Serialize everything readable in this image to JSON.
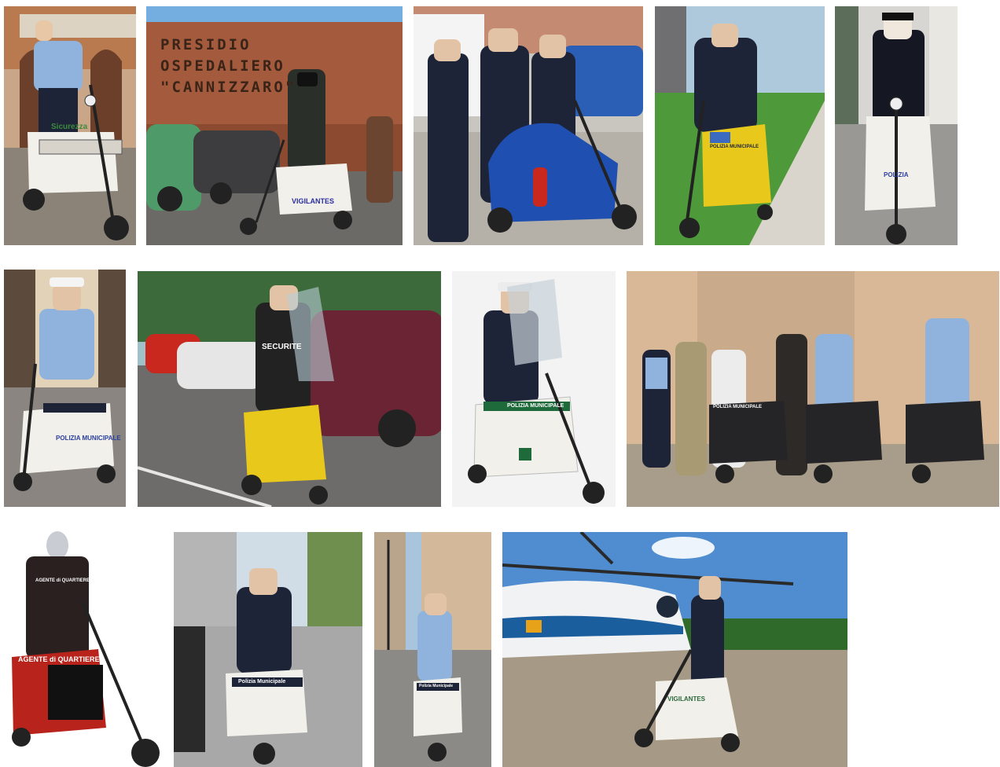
{
  "collage": {
    "photos": [
      {
        "id": "p1",
        "scene": "officer-on-white-three-wheel-scooter",
        "decal": "Sicurezza"
      },
      {
        "id": "p2",
        "scene": "guard-scooter-outside-hospital",
        "sign_text": "PRESIDIO\nOSPEDALIERO\n\"CANNIZZARO\"",
        "decal": "VIGILANTES"
      },
      {
        "id": "p3",
        "scene": "three-officers-with-blue-scooter"
      },
      {
        "id": "p4",
        "scene": "officer-on-yellow-scooter-on-lawn",
        "decal": "POLIZIA MUNICIPALE"
      },
      {
        "id": "p5",
        "scene": "officer-on-white-scooter-street",
        "decal": "POLIZIA"
      },
      {
        "id": "p6",
        "scene": "officer-on-scooter-square",
        "decal": "POLIZIA MUNICIPALE"
      },
      {
        "id": "p7",
        "scene": "rider-on-yellow-scooter-parking-lot",
        "vest": "SECURITE"
      },
      {
        "id": "p8",
        "scene": "officer-on-white-scooter-studio",
        "decal": "POLIZIA MUNICIPALE"
      },
      {
        "id": "p9",
        "scene": "group-of-officers-with-three-scooters",
        "decal": "POLIZIA MUNICIPALE"
      },
      {
        "id": "p10",
        "scene": "mannequin-on-red-scooter",
        "vest": "AGENTE di QUARTIERE",
        "decal": "AGENTE di QUARTIERE"
      },
      {
        "id": "p11",
        "scene": "officer-on-scooter-tree-lined-road",
        "decal": "Polizia Municipale"
      },
      {
        "id": "p12",
        "scene": "officer-on-scooter-historic-street",
        "decal": "Polizia Municipale"
      },
      {
        "id": "p13",
        "scene": "guard-with-scooter-by-helicopter",
        "decal": "VIGILANTES"
      }
    ]
  },
  "colors": {
    "scooter_white": "#f2f0ea",
    "scooter_yellow": "#e8c81a",
    "scooter_blue": "#1f4fb0",
    "scooter_red": "#b8241c",
    "uniform_navy": "#1d2438",
    "shirt_blue": "#8fb3dc"
  }
}
